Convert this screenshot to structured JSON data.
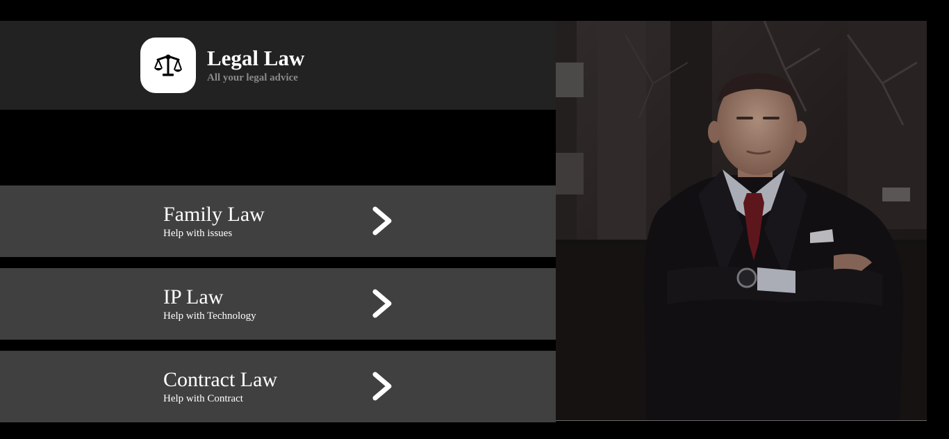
{
  "brand": {
    "title": "Legal Law",
    "subtitle": "All your legal advice",
    "logo_icon": "scales-icon"
  },
  "services": [
    {
      "title": "Family Law",
      "description": "Help with issues",
      "icon": "chevron-right-icon"
    },
    {
      "title": "IP Law",
      "description": "Help with Technology",
      "icon": "chevron-right-icon"
    },
    {
      "title": "Contract Law",
      "description": "Help with Contract",
      "icon": "chevron-right-icon"
    }
  ],
  "colors": {
    "background": "#000000",
    "header": "#222222",
    "card": "#404040",
    "text": "#ffffff",
    "subtitle": "#8a8a8a"
  }
}
